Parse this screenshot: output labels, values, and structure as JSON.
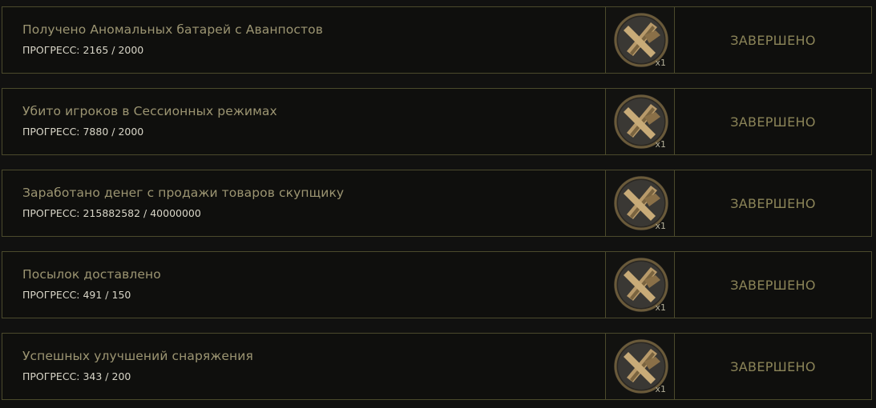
{
  "tasks": [
    {
      "title": "Получено Аномальных батарей с Аванпостов",
      "progress": "ПРОГРЕСС: 2165 / 2000",
      "reward_icon": "crossed-tools-coin-icon",
      "reward_qty": "x1",
      "status": "ЗАВЕРШЕНО"
    },
    {
      "title": "Убито игроков в Сессионных режимах",
      "progress": "ПРОГРЕСС: 7880 / 2000",
      "reward_icon": "crossed-tools-coin-icon",
      "reward_qty": "x1",
      "status": "ЗАВЕРШЕНО"
    },
    {
      "title": "Заработано денег с продажи товаров скупщику",
      "progress": "ПРОГРЕСС: 215882582 / 40000000",
      "reward_icon": "crossed-tools-coin-icon",
      "reward_qty": "x1",
      "status": "ЗАВЕРШЕНО"
    },
    {
      "title": "Посылок доставлено",
      "progress": "ПРОГРЕСС: 491 / 150",
      "reward_icon": "crossed-tools-coin-icon",
      "reward_qty": "x1",
      "status": "ЗАВЕРШЕНО"
    },
    {
      "title": "Успешных улучшений снаряжения",
      "progress": "ПРОГРЕСС: 343 / 200",
      "reward_icon": "crossed-tools-coin-icon",
      "reward_qty": "x1",
      "status": "ЗАВЕРШЕНО"
    }
  ],
  "colors": {
    "border": "#4b4a2c",
    "title": "#9c9572",
    "status": "#8b8458",
    "coin_rim": "#6a5a3a",
    "coin_face": "#3a3834",
    "coin_tools": "#b89a6a"
  }
}
